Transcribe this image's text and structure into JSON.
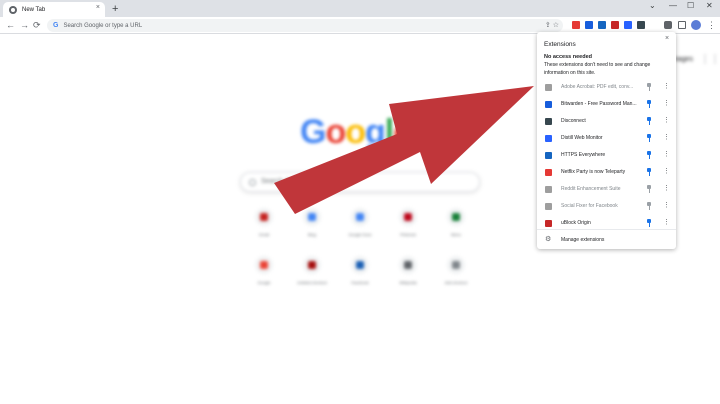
{
  "browser": {
    "tab_title": "New Tab",
    "tab_close": "×",
    "new_tab": "+",
    "window_controls": [
      "⌄",
      "—",
      "☐",
      "✕"
    ],
    "nav": {
      "back": "←",
      "forward": "→",
      "reload": "⟳"
    },
    "omnibox": {
      "icon": "G",
      "placeholder": "Search Google or type a URL"
    },
    "toolbar_extensions": [
      {
        "icon": "tp-icon",
        "color": "#e53935"
      },
      {
        "icon": "bitwarden-icon",
        "color": "#175ddc"
      },
      {
        "icon": "https-icon",
        "color": "#1565c0"
      },
      {
        "icon": "ublock-icon",
        "color": "#c62828"
      },
      {
        "icon": "distill-icon",
        "color": "#2962ff"
      },
      {
        "icon": "disconnect-icon",
        "color": "#37474f"
      }
    ],
    "menu": "⋮"
  },
  "newtab": {
    "logo": "Google",
    "logo_colors": [
      "#4285f4",
      "#ea4335",
      "#fbbc05",
      "#4285f4",
      "#34a853",
      "#ea4335"
    ],
    "search_placeholder": "Search Google or type a URL",
    "images_link": "Images",
    "apps": "⋮⋮",
    "shortcuts_row1": [
      {
        "label": "Gmail",
        "color": "#c5221f"
      },
      {
        "label": "Blog",
        "color": "#4285f4"
      },
      {
        "label": "Google Docs",
        "color": "#4285f4"
      },
      {
        "label": "Pinterest",
        "color": "#bd081c"
      },
      {
        "label": "Menu",
        "color": "#188038"
      }
    ],
    "shortcuts_row2": [
      {
        "label": "Google",
        "color": "#ea4335"
      },
      {
        "label": "Unlisted shortcut",
        "color": "#a50e0e"
      },
      {
        "label": "Facebook",
        "color": "#1a5fb4"
      },
      {
        "label": "Wikipedia",
        "color": "#5f6368"
      },
      {
        "label": "Add shortcut",
        "color": "#80868b"
      }
    ]
  },
  "extensions_popup": {
    "title": "Extensions",
    "close": "×",
    "section_title": "No access needed",
    "section_desc": "These extensions don't need to see and change information on this site.",
    "items": [
      {
        "name": "Adobe Acrobat: PDF edit, conv...",
        "icon": "acrobat-icon",
        "color": "#9e9e9e",
        "pinned": false,
        "dim": true
      },
      {
        "name": "Bitwarden - Free Password Man...",
        "icon": "bitwarden-icon",
        "color": "#175ddc",
        "pinned": true,
        "dim": false
      },
      {
        "name": "Disconnect",
        "icon": "disconnect-icon",
        "color": "#37474f",
        "pinned": true,
        "dim": false
      },
      {
        "name": "Distill Web Monitor",
        "icon": "distill-icon",
        "color": "#2962ff",
        "pinned": true,
        "dim": false
      },
      {
        "name": "HTTPS Everywhere",
        "icon": "https-icon",
        "color": "#1565c0",
        "pinned": true,
        "dim": false
      },
      {
        "name": "Netflix Party is now Teleparty",
        "icon": "teleparty-icon",
        "color": "#e53935",
        "pinned": true,
        "dim": false
      },
      {
        "name": "Reddit Enhancement Suite",
        "icon": "reddit-icon",
        "color": "#9e9e9e",
        "pinned": false,
        "dim": true
      },
      {
        "name": "Social Fixer for Facebook",
        "icon": "socialfixer-icon",
        "color": "#9e9e9e",
        "pinned": false,
        "dim": true
      },
      {
        "name": "uBlock Origin",
        "icon": "ublock-icon",
        "color": "#c62828",
        "pinned": true,
        "dim": false
      }
    ],
    "more_icon": "⋮",
    "manage_label": "Manage extensions",
    "manage_icon": "⚙"
  },
  "annotation": {
    "arrow_color": "#c0363a"
  }
}
